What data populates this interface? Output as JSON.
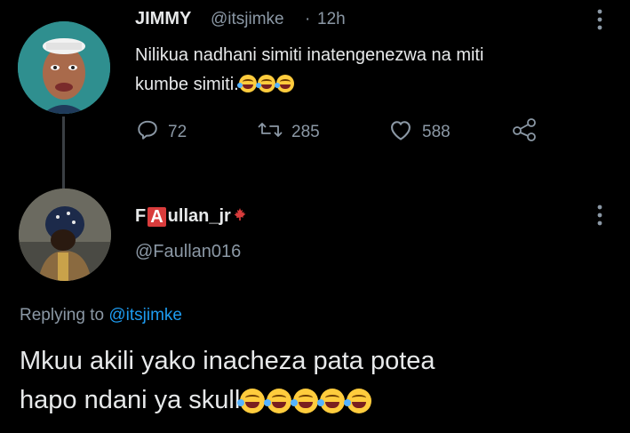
{
  "tweet": {
    "name": "JIMMY",
    "handle": "@itsjimke",
    "separator": "·",
    "time": "12h",
    "text_line1": "Nilikua nadhani simiti inatengenezwa na miti",
    "text_line2": "kumbe simiti.",
    "emoji_count": 3,
    "replies": "72",
    "retweets": "285",
    "likes": "588"
  },
  "reply": {
    "name_prefix": "F",
    "name_box_letter": "A",
    "name_suffix": "ullan_jr",
    "handle": "@Faullan016",
    "replying_label": "Replying to",
    "replying_mention": "@itsjimke",
    "text_line1": "Mkuu akili yako inacheza pata potea",
    "text_line2": "hapo ndani ya skull",
    "emoji_count": 5
  },
  "icons": {
    "reply": "reply-icon",
    "retweet": "retweet-icon",
    "like": "heart-icon",
    "share": "share-icon",
    "more": "more-icon",
    "flag": "maple-leaf-icon"
  },
  "colors": {
    "background": "#000000",
    "text": "#e7e9ea",
    "muted": "#8b98a5",
    "link": "#1d9bf0",
    "badge": "#d93c3c"
  }
}
